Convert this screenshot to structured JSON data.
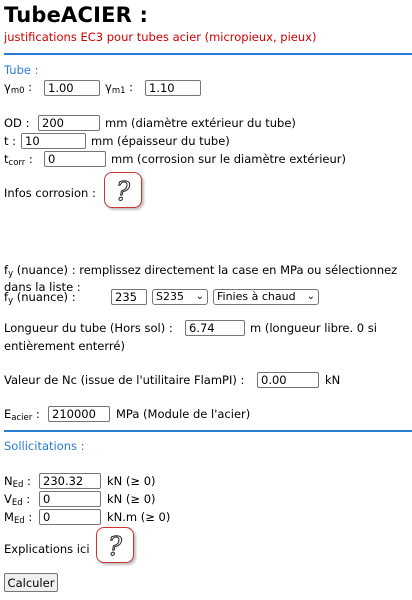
{
  "header": {
    "title": "TubeACIER :",
    "subtitle": "justifications EC3 pour tubes acier (micropieux, pieux)"
  },
  "tube_section": {
    "heading": "Tube :",
    "gamma_m0": {
      "label": "γ",
      "sub": "m0",
      "sep": " :",
      "value": "1.00"
    },
    "gamma_m1": {
      "label": "γ",
      "sub": "m1",
      "sep": " :",
      "value": "1.10"
    },
    "od": {
      "label": "OD :",
      "value": "200",
      "unit": "mm (diamètre extérieur du tube)"
    },
    "t": {
      "label": "t :",
      "value": "10",
      "unit": "mm (épaisseur du tube)"
    },
    "t_corr": {
      "label": "t",
      "sub": "corr",
      "sep": " :",
      "value": "0",
      "unit": "mm (corrosion sur le diamètre extérieur)"
    },
    "infos_corrosion": "Infos corrosion :",
    "fy_note": "f",
    "fy_note_sub": "y",
    "fy_note_text": " (nuance) : remplissez directement la case en MPa ou sélectionnez",
    "fy_note_line2": "dans la liste :",
    "fy": {
      "label": "f",
      "sub": "y",
      "label_rest": " (nuance) :",
      "value": "235",
      "grade": "S235",
      "finish": "Finies à chaud"
    },
    "length": {
      "label": "Longueur du tube (Hors sol) :",
      "value": "6.74",
      "unit": "m (longueur libre. 0 si",
      "unit_line2": "entièrement enterré)"
    },
    "nc": {
      "label": "Valeur de Nc (issue de l'utilitaire FlamPI) :",
      "value": "0.00",
      "unit": "kN"
    },
    "e_acier": {
      "label": "E",
      "sub": "acier",
      "sep": " :",
      "value": "210000",
      "unit": "MPa (Module de l'acier)"
    }
  },
  "loads_section": {
    "heading": "Sollicitations :",
    "ned": {
      "label": "N",
      "sub": "Ed",
      "sep": " :",
      "value": "230.32",
      "unit": "kN (≥ 0)"
    },
    "ved": {
      "label": "V",
      "sub": "Ed",
      "sep": " :",
      "value": "0",
      "unit": "kN (≥ 0)"
    },
    "med": {
      "label": "M",
      "sub": "Ed",
      "sep": " :",
      "value": "0",
      "unit": "kN.m (≥ 0)"
    },
    "explications": "Explications ici"
  },
  "buttons": {
    "calculate": "Calculer"
  },
  "icons": {
    "help": "question-mark-icon",
    "dropdown": "chevron-down-icon"
  },
  "colors": {
    "accent": "#2b7bd4",
    "subtitle": "#d00000",
    "help_border": "#cc3333"
  }
}
